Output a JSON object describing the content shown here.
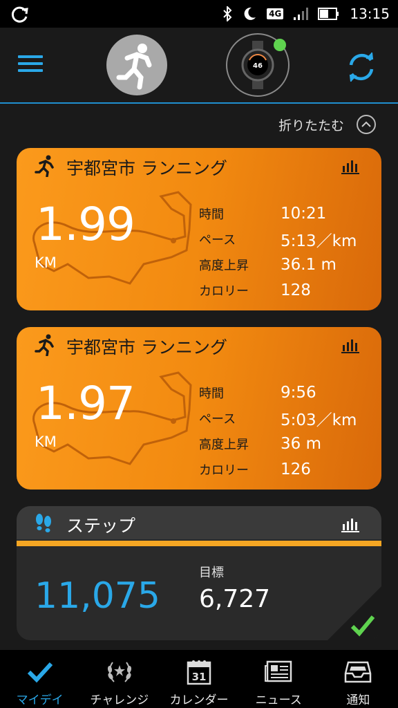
{
  "statusbar": {
    "network": "4G",
    "time": "13:15"
  },
  "header": {
    "menu_icon": "hamburger-icon",
    "avatar_icon": "running-person-icon",
    "device_icon": "watch-icon",
    "device_status_color": "#5fd34f",
    "sync_icon": "sync-icon"
  },
  "collapse": {
    "label": "折りたたむ"
  },
  "activities": [
    {
      "title": "宇都宮市 ランニング",
      "distance": "1.99",
      "unit": "KM",
      "stats": [
        {
          "label": "時間",
          "value": "10:21"
        },
        {
          "label": "ペース",
          "value": "5:13／km"
        },
        {
          "label": "高度上昇",
          "value": "36.1 m"
        },
        {
          "label": "カロリー",
          "value": "128"
        }
      ]
    },
    {
      "title": "宇都宮市 ランニング",
      "distance": "1.97",
      "unit": "KM",
      "stats": [
        {
          "label": "時間",
          "value": "9:56"
        },
        {
          "label": "ペース",
          "value": "5:03／km"
        },
        {
          "label": "高度上昇",
          "value": "36 m"
        },
        {
          "label": "カロリー",
          "value": "126"
        }
      ]
    }
  ],
  "steps": {
    "title": "ステップ",
    "value": "11,075",
    "goal_label": "目標",
    "goal_value": "6,727",
    "accent": "#2aa8e8",
    "goal_met_color": "#5fd34f"
  },
  "nav": [
    {
      "label": "マイデイ",
      "icon": "checkmark-icon",
      "active": true
    },
    {
      "label": "チャレンジ",
      "icon": "laurel-icon"
    },
    {
      "label": "カレンダー",
      "icon": "calendar-icon",
      "calendar_day": "31"
    },
    {
      "label": "ニュース",
      "icon": "newspaper-icon"
    },
    {
      "label": "通知",
      "icon": "inbox-icon"
    }
  ]
}
